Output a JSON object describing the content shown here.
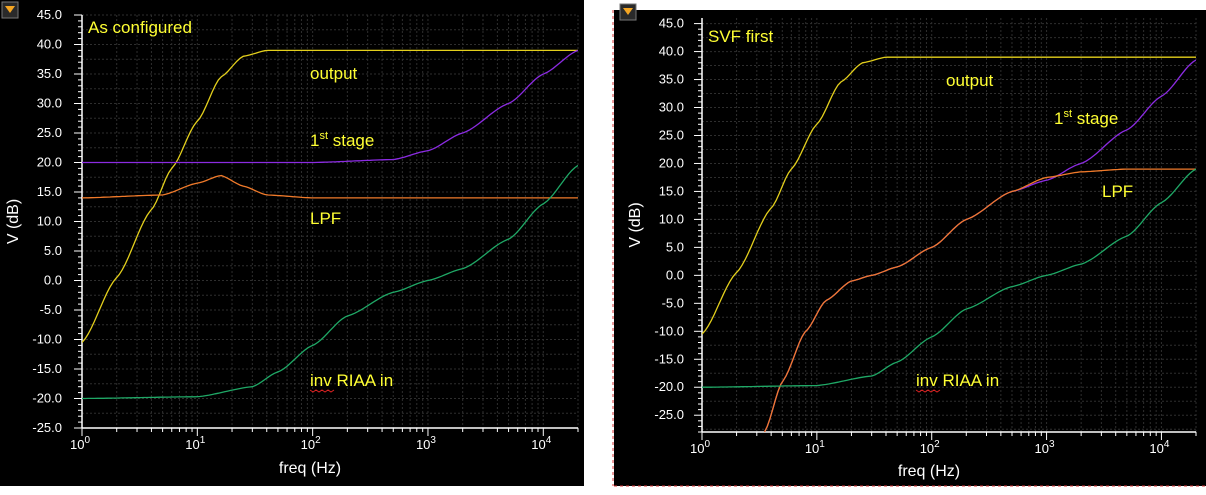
{
  "colors": {
    "background": "#000000",
    "axis": "#ffffff",
    "grid": "#2e2e2e",
    "annotation": "#ffff33",
    "output": "#e3cf1c",
    "first_stage": "#8b2be2",
    "lpf": "#f07a2a",
    "inv_riaa": "#1fa866",
    "separator": "#d83a3a",
    "collapse_icon": "#f5a623"
  },
  "icons": [
    "collapse-triangle-icon"
  ],
  "chart_data": [
    {
      "type": "line",
      "title": "As configured",
      "xlabel": "freq (Hz)",
      "ylabel": "V (dB)",
      "xscale": "log",
      "xlim": [
        1,
        20000
      ],
      "ylim": [
        -25,
        45
      ],
      "x_ticks": [
        {
          "base": "10",
          "exp": "0"
        },
        {
          "base": "10",
          "exp": "1"
        },
        {
          "base": "10",
          "exp": "2"
        },
        {
          "base": "10",
          "exp": "3"
        },
        {
          "base": "10",
          "exp": "4"
        }
      ],
      "y_ticks": [
        "45.0",
        "40.0",
        "35.0",
        "30.0",
        "25.0",
        "20.0",
        "15.0",
        "10.0",
        "5.0",
        "0.0",
        "-5.0",
        "-10.0",
        "-15.0",
        "-20.0",
        "-25.0"
      ],
      "grid": true,
      "annotations": [
        {
          "series": "output",
          "text": "output"
        },
        {
          "series": "first_stage",
          "text": "1",
          "sup": "st",
          "rest": " stage"
        },
        {
          "series": "lpf",
          "text": "LPF"
        },
        {
          "series": "inv_riaa",
          "text": "inv RIAA in"
        }
      ],
      "series": [
        {
          "key": "output",
          "x": [
            1,
            2,
            4,
            6,
            10,
            16,
            25,
            40,
            100,
            1000,
            20000
          ],
          "y": [
            -10.5,
            0.5,
            12,
            19,
            27,
            34.5,
            38,
            39,
            39,
            39,
            39
          ]
        },
        {
          "key": "first_stage",
          "x": [
            1,
            10,
            100,
            500,
            1000,
            2000,
            5000,
            10000,
            20000
          ],
          "y": [
            20,
            20,
            20,
            20.5,
            22,
            25,
            30,
            35,
            39
          ]
        },
        {
          "key": "lpf",
          "x": [
            1,
            5,
            10,
            16,
            25,
            40,
            100,
            1000,
            20000
          ],
          "y": [
            14,
            14.5,
            16.5,
            17.8,
            16,
            14.5,
            14,
            14,
            14
          ]
        },
        {
          "key": "inv_riaa",
          "x": [
            1,
            10,
            30,
            50,
            100,
            200,
            500,
            1000,
            2000,
            5000,
            10000,
            20000
          ],
          "y": [
            -20,
            -19.7,
            -18,
            -15.5,
            -11,
            -6,
            -2,
            0,
            2,
            7,
            13,
            19.5
          ]
        }
      ]
    },
    {
      "type": "line",
      "title": "SVF first",
      "xlabel": "freq (Hz)",
      "ylabel": "V (dB)",
      "xscale": "log",
      "xlim": [
        1,
        20000
      ],
      "ylim": [
        -28,
        46
      ],
      "x_ticks": [
        {
          "base": "10",
          "exp": "0"
        },
        {
          "base": "10",
          "exp": "1"
        },
        {
          "base": "10",
          "exp": "2"
        },
        {
          "base": "10",
          "exp": "3"
        },
        {
          "base": "10",
          "exp": "4"
        }
      ],
      "y_ticks": [
        "45.0",
        "40.0",
        "35.0",
        "30.0",
        "25.0",
        "20.0",
        "15.0",
        "10.0",
        "5.0",
        "0.0",
        "-5.0",
        "-10.0",
        "-15.0",
        "-20.0",
        "-25.0"
      ],
      "grid": true,
      "annotations": [
        {
          "series": "output",
          "text": "output"
        },
        {
          "series": "first_stage",
          "text": "1",
          "sup": "st",
          "rest": " stage"
        },
        {
          "series": "lpf",
          "text": "LPF"
        },
        {
          "series": "inv_riaa",
          "text": "inv RIAA in"
        }
      ],
      "series": [
        {
          "key": "output",
          "x": [
            1,
            2,
            4,
            6,
            10,
            16,
            25,
            40,
            100,
            1000,
            20000
          ],
          "y": [
            -10.5,
            0.5,
            12,
            19,
            27,
            34.5,
            38,
            39,
            39,
            39,
            39
          ]
        },
        {
          "key": "first_stage",
          "x": [
            3.5,
            5,
            8,
            12,
            20,
            30,
            50,
            100,
            200,
            500,
            1000,
            2000,
            5000,
            10000,
            20000
          ],
          "y": [
            -28,
            -19,
            -10,
            -4.5,
            -1,
            0,
            1.5,
            5,
            10,
            15,
            17,
            20,
            26,
            32,
            38.5
          ]
        },
        {
          "key": "lpf",
          "x": [
            3.5,
            5,
            8,
            12,
            20,
            30,
            50,
            100,
            200,
            500,
            1000,
            2000,
            5000,
            10000,
            20000
          ],
          "y": [
            -28,
            -19,
            -10,
            -4.5,
            -1,
            0,
            1.5,
            5,
            10,
            15,
            17.5,
            18.5,
            19,
            19,
            19
          ]
        },
        {
          "key": "inv_riaa",
          "x": [
            1,
            10,
            30,
            50,
            100,
            200,
            500,
            1000,
            2000,
            5000,
            10000,
            20000
          ],
          "y": [
            -20,
            -19.7,
            -18,
            -15.5,
            -11,
            -6,
            -2,
            0,
            2,
            7,
            13,
            19
          ]
        }
      ]
    }
  ]
}
